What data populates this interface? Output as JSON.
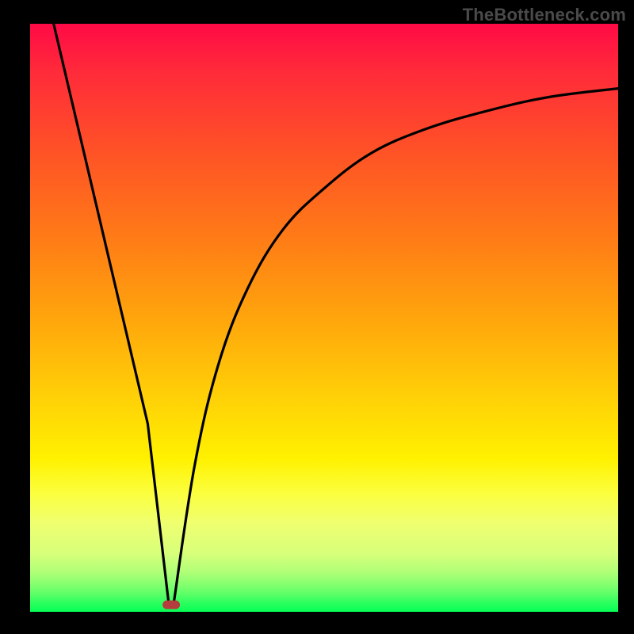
{
  "watermark": "TheBottleneck.com",
  "chart_data": {
    "type": "line",
    "title": "",
    "xlabel": "",
    "ylabel": "",
    "xlim": [
      0,
      100
    ],
    "ylim": [
      0,
      100
    ],
    "grid": false,
    "legend": false,
    "background": "red-yellow-green vertical gradient",
    "series": [
      {
        "name": "left-descent",
        "x": [
          4,
          8,
          12,
          16,
          20,
          23.5
        ],
        "values": [
          100,
          83,
          66,
          49,
          32,
          2
        ]
      },
      {
        "name": "right-rise",
        "x": [
          24.5,
          28,
          32,
          37,
          43,
          50,
          58,
          67,
          77,
          88,
          100
        ],
        "values": [
          2,
          25,
          42,
          55,
          65,
          72,
          78,
          82,
          85,
          87.5,
          89
        ]
      }
    ],
    "marker": {
      "x": 24,
      "y": 1.2,
      "shape": "rounded-rect",
      "color": "#b63d3d"
    }
  }
}
